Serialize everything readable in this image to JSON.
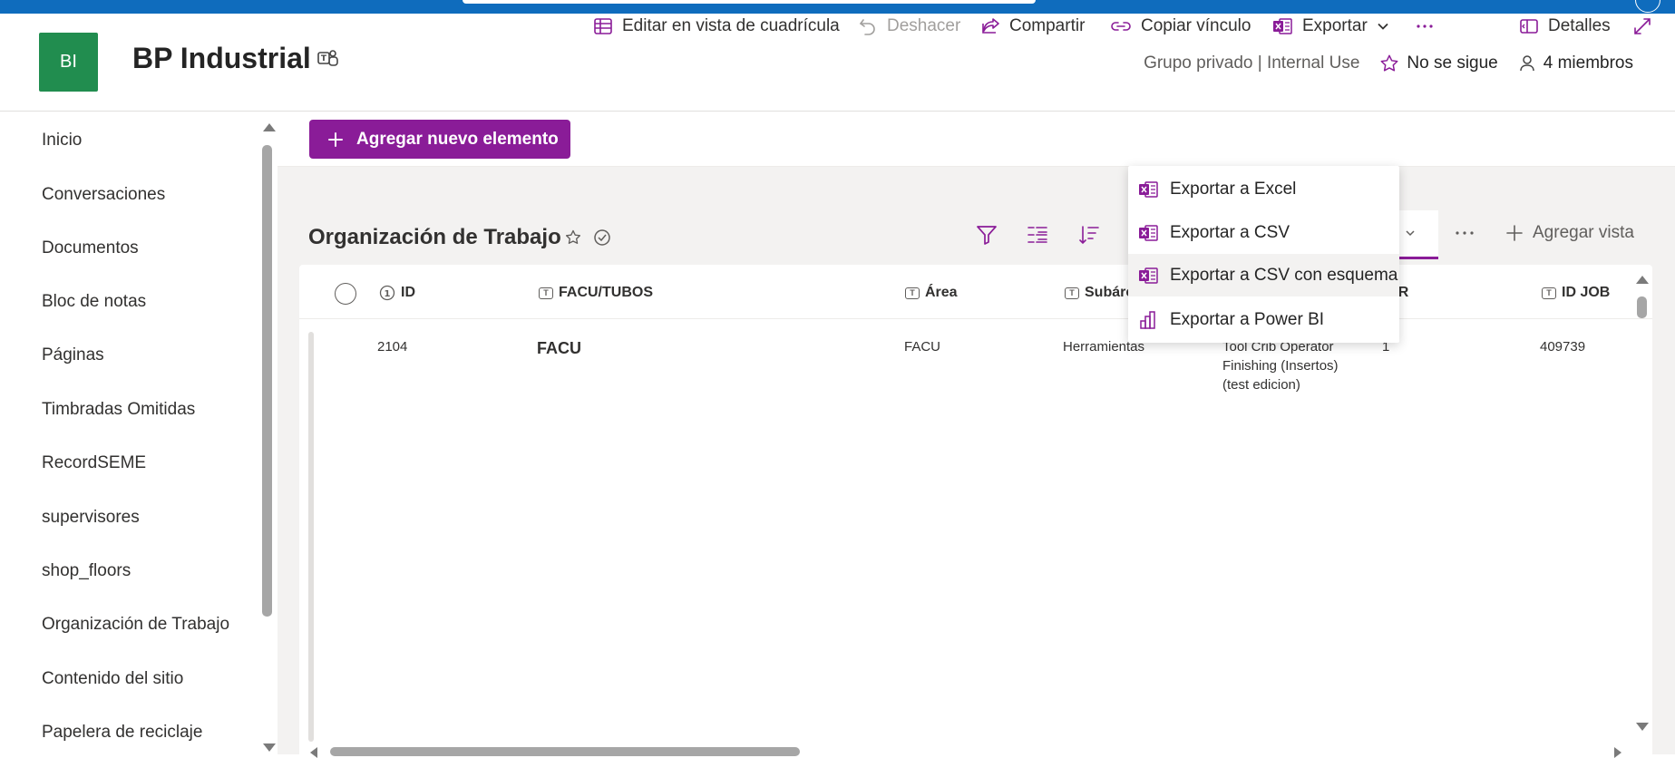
{
  "site": {
    "logo_text": "BI",
    "title": "BP Industrial",
    "privacy": "Grupo privado | Internal Use",
    "follow_label": "No se sigue",
    "members_label": "4 miembros"
  },
  "nav": {
    "items": [
      {
        "label": "Inicio"
      },
      {
        "label": "Conversaciones"
      },
      {
        "label": "Documentos"
      },
      {
        "label": "Bloc de notas"
      },
      {
        "label": "Páginas"
      },
      {
        "label": "Timbradas Omitidas"
      },
      {
        "label": "RecordSEME"
      },
      {
        "label": "supervisores"
      },
      {
        "label": "shop_floors"
      },
      {
        "label": "Organización de Trabajo"
      },
      {
        "label": "Contenido del sitio"
      },
      {
        "label": "Papelera de reciclaje"
      }
    ]
  },
  "commandbar": {
    "new_item": "Agregar nuevo elemento",
    "grid_edit": "Editar en vista de cuadrícula",
    "undo": "Deshacer",
    "share": "Compartir",
    "copy_link": "Copiar vínculo",
    "export": "Exportar",
    "details": "Detalles"
  },
  "export_menu": {
    "items": [
      {
        "label": "Exportar a Excel"
      },
      {
        "label": "Exportar a CSV"
      },
      {
        "label": "Exportar a CSV con esquema"
      },
      {
        "label": "Exportar a Power BI"
      }
    ]
  },
  "list": {
    "title": "Organización de Trabajo",
    "add_view": "Agregar vista",
    "columns": {
      "id": "ID",
      "facu": "FACU/TUBOS",
      "area": "Área",
      "subarea": "Subárea",
      "tr": "TR",
      "idjob": "ID JOB"
    },
    "rows": [
      {
        "id": "2104",
        "facu": "FACU",
        "area": "FACU",
        "subarea": "Herramientas",
        "puesto_line1": "Tool Crib Operator",
        "puesto_line2": "Finishing (Insertos)",
        "puesto_line3": "(test edicion)",
        "tr": "1",
        "idjob": "409739"
      }
    ]
  },
  "colors": {
    "accent": "#8a1c98",
    "suite_bar": "#0f6cbd",
    "logo_bg": "#218d4f"
  }
}
